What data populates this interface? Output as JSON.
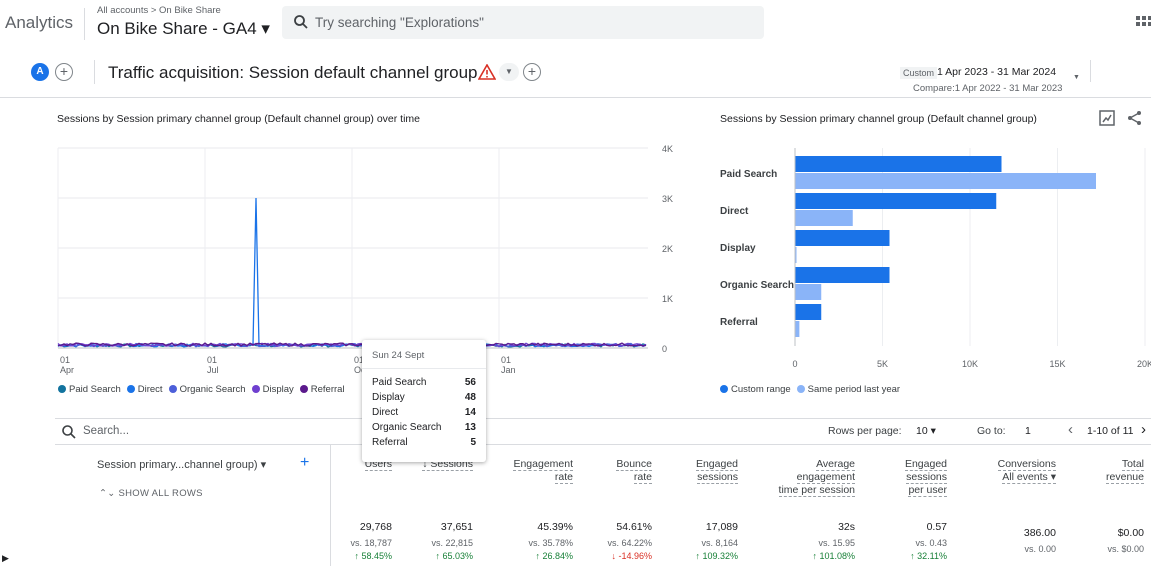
{
  "app": {
    "name": "Analytics",
    "breadcrumb": "All accounts > On Bike Share",
    "property": "On Bike Share - GA4 ▾"
  },
  "search": {
    "placeholder": "Try searching \"Explorations\"",
    "icon": "search-icon"
  },
  "report": {
    "avatar": "A",
    "title": "Traffic acquisition: Session default channel group",
    "date_badge": "Custom",
    "date_range": "1 Apr 2023 - 31 Mar 2024",
    "compare": "Compare:1 Apr 2022 - 31 Mar 2023"
  },
  "line_card": {
    "title": "Sessions by Session primary channel group (Default channel group) over time",
    "legend": [
      {
        "label": "Paid Search",
        "color": "#12739e"
      },
      {
        "label": "Direct",
        "color": "#1a73e8"
      },
      {
        "label": "Organic Search",
        "color": "#4c5fd9"
      },
      {
        "label": "Display",
        "color": "#6f3fcf"
      },
      {
        "label": "Referral",
        "color": "#5b1a8c"
      }
    ]
  },
  "bar_card": {
    "title": "Sessions by Session primary channel group (Default channel group)",
    "legend": [
      {
        "label": "Custom range",
        "color": "#1a73e8"
      },
      {
        "label": "Same period last year",
        "color": "#8ab4f8"
      }
    ]
  },
  "chart_data": [
    {
      "type": "line",
      "y_ticks": [
        "4K",
        "3K",
        "2K",
        "1K",
        "0"
      ],
      "ylim": [
        0,
        4000
      ],
      "x_ticks": [
        {
          "top": "01",
          "bottom": "Apr"
        },
        {
          "top": "01",
          "bottom": "Jul"
        },
        {
          "top": "01",
          "bottom": "Oct"
        },
        {
          "top": "01",
          "bottom": "Jan"
        }
      ],
      "peak": {
        "series": "Direct",
        "value": 3000,
        "period": "Jul"
      }
    },
    {
      "type": "bar",
      "orientation": "horizontal",
      "categories": [
        "Paid Search",
        "Direct",
        "Display",
        "Organic Search",
        "Referral"
      ],
      "series": [
        {
          "name": "Custom range",
          "values": [
            11800,
            11500,
            5400,
            5400,
            1500
          ]
        },
        {
          "name": "Same period last year",
          "values": [
            17200,
            3300,
            50,
            1500,
            250
          ]
        }
      ],
      "x_ticks": [
        "0",
        "5K",
        "10K",
        "15K",
        "20K"
      ],
      "xlim": [
        0,
        20000
      ]
    }
  ],
  "tooltip": {
    "date": "Sun 24 Sept",
    "rows": [
      {
        "label": "Paid Search",
        "value": "56"
      },
      {
        "label": "Display",
        "value": "48"
      },
      {
        "label": "Direct",
        "value": "14"
      },
      {
        "label": "Organic Search",
        "value": "13"
      },
      {
        "label": "Referral",
        "value": "5"
      }
    ]
  },
  "table": {
    "search_placeholder": "Search...",
    "rows_per_page_label": "Rows per page:",
    "rows_per_page": "10 ▾",
    "goto_label": "Go to:",
    "goto_value": "1",
    "pagination": "1-10 of 11",
    "dimension_header": "Session primary...channel group) ▾",
    "show_all": "SHOW ALL ROWS",
    "columns": [
      {
        "l1": "Users",
        "l2": "",
        "l3": "",
        "value": "29,768",
        "vs": "vs. 18,787",
        "change": "↑ 58.45%",
        "dir": "up"
      },
      {
        "l1": "↓ Sessions",
        "l2": "",
        "l3": "",
        "value": "37,651",
        "vs": "vs. 22,815",
        "change": "↑ 65.03%",
        "dir": "up"
      },
      {
        "l1": "Engagement",
        "l2": "rate",
        "l3": "",
        "value": "45.39%",
        "vs": "vs. 35.78%",
        "change": "↑ 26.84%",
        "dir": "up"
      },
      {
        "l1": "Bounce",
        "l2": "rate",
        "l3": "",
        "value": "54.61%",
        "vs": "vs. 64.22%",
        "change": "↓ -14.96%",
        "dir": "down"
      },
      {
        "l1": "Engaged",
        "l2": "sessions",
        "l3": "",
        "value": "17,089",
        "vs": "vs. 8,164",
        "change": "↑ 109.32%",
        "dir": "up"
      },
      {
        "l1": "Average",
        "l2": "engagement",
        "l3": "time per session",
        "value": "32s",
        "vs": "vs. 15.95",
        "change": "↑ 101.08%",
        "dir": "up"
      },
      {
        "l1": "Engaged",
        "l2": "sessions",
        "l3": "per user",
        "value": "0.57",
        "vs": "vs. 0.43",
        "change": "↑ 32.11%",
        "dir": "up"
      },
      {
        "l1": "Conversions",
        "l2": "All events ▾",
        "l3": "",
        "value": "386.00",
        "vs": "vs. 0.00",
        "change": "",
        "dir": ""
      },
      {
        "l1": "Total",
        "l2": "revenue",
        "l3": "",
        "value": "$0.00",
        "vs": "vs. $0.00",
        "change": "",
        "dir": ""
      }
    ]
  }
}
